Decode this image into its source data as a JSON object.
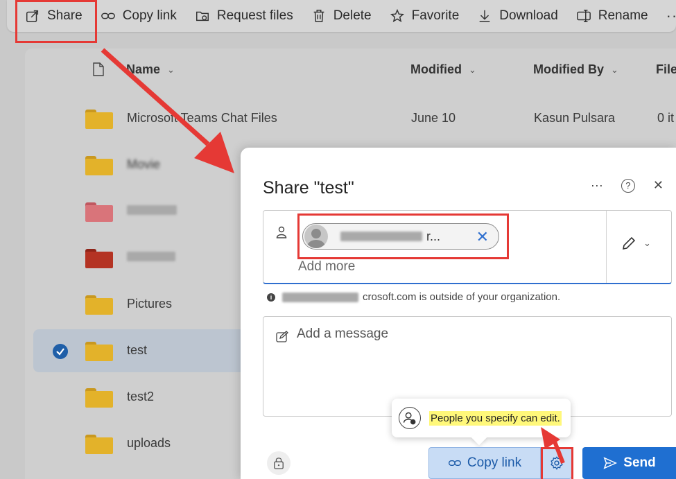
{
  "toolbar": {
    "share_label": "Share",
    "copy_link_label": "Copy link",
    "request_files_label": "Request files",
    "delete_label": "Delete",
    "favorite_label": "Favorite",
    "download_label": "Download",
    "rename_label": "Rename",
    "more_label": "··"
  },
  "list": {
    "headers": {
      "name": "Name",
      "modified": "Modified",
      "modified_by": "Modified By",
      "file_size": "File"
    },
    "rows": [
      {
        "name": "Microsoft Teams Chat Files",
        "modified": "June 10",
        "modified_by": "Kasun Pulsara",
        "items": "0 it",
        "folder_color": "#e3b22a"
      },
      {
        "name": "Movie",
        "modified": "",
        "modified_by": "",
        "items": "",
        "folder_color": "#e3b22a"
      },
      {
        "name": "",
        "modified": "",
        "modified_by": "",
        "items": "",
        "folder_color": "#d9747a"
      },
      {
        "name": "",
        "modified": "",
        "modified_by": "",
        "items": "",
        "folder_color": "#b43323"
      },
      {
        "name": "Pictures",
        "modified": "",
        "modified_by": "",
        "items": "",
        "folder_color": "#e3b22a"
      },
      {
        "name": "test",
        "modified": "",
        "modified_by": "",
        "items": "",
        "folder_color": "#e3b22a"
      },
      {
        "name": "test2",
        "modified": "",
        "modified_by": "",
        "items": "",
        "folder_color": "#e3b22a"
      },
      {
        "name": "uploads",
        "modified": "",
        "modified_by": "",
        "items": "",
        "folder_color": "#e3b22a"
      }
    ]
  },
  "dialog": {
    "title": "Share \"test\"",
    "more_label": "···",
    "help_label": "?",
    "close_label": "✕",
    "recipient_chip_text": "r...",
    "add_more_placeholder": "Add more",
    "outside_org_notice": "crosoft.com is outside of your organization.",
    "message_placeholder": "Add a message",
    "tooltip_text": "People you specify can edit.",
    "copy_link_label": "Copy link",
    "send_label": "Send"
  },
  "colors": {
    "accent": "#1f6fd1",
    "folder_yellow": "#e3b22a",
    "annotation_red": "#e53935",
    "highlight_yellow": "#fff87a"
  }
}
